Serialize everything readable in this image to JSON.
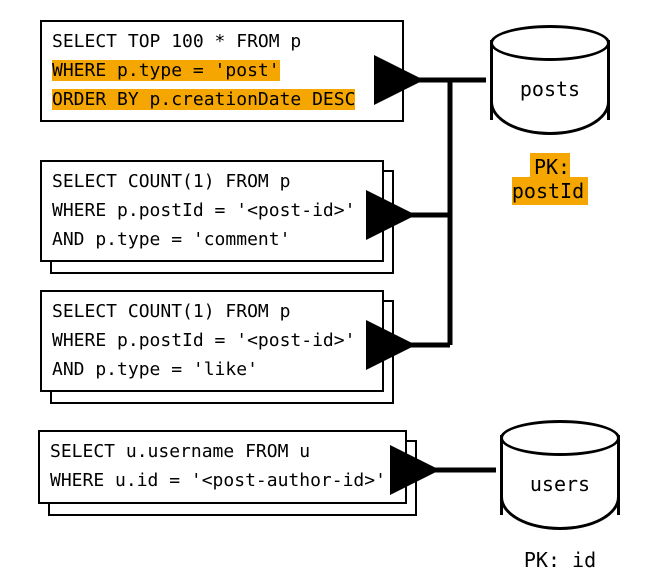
{
  "queries": {
    "q1": {
      "line1": "SELECT TOP 100 * FROM p",
      "line2": "WHERE p.type = 'post'",
      "line3": "ORDER BY p.creationDate DESC"
    },
    "q2": {
      "line1": "SELECT COUNT(1) FROM p",
      "line2": "WHERE p.postId = '<post-id>'",
      "line3": "AND p.type = 'comment'"
    },
    "q3": {
      "line1": "SELECT COUNT(1) FROM p",
      "line2": "WHERE p.postId = '<post-id>'",
      "line3": "AND p.type = 'like'"
    },
    "q4": {
      "line1": "SELECT u.username FROM u",
      "line2": "WHERE u.id = '<post-author-id>'"
    }
  },
  "databases": {
    "posts": {
      "label": "posts",
      "pk": "PK: postId"
    },
    "users": {
      "label": "users",
      "pk": "PK: id"
    }
  },
  "chart_data": {
    "type": "diagram",
    "description": "Four SQL query boxes with arrows from two database cylinders",
    "query_boxes": [
      {
        "sql": "SELECT TOP 100 * FROM p WHERE p.type = 'post' ORDER BY p.creationDate DESC",
        "highlighted_lines": [
          "WHERE p.type = 'post'",
          "ORDER BY p.creationDate DESC"
        ],
        "stacked": false,
        "source_db": "posts"
      },
      {
        "sql": "SELECT COUNT(1) FROM p WHERE p.postId = '<post-id>' AND p.type = 'comment'",
        "highlighted_lines": [],
        "stacked": true,
        "source_db": "posts"
      },
      {
        "sql": "SELECT COUNT(1) FROM p WHERE p.postId = '<post-id>' AND p.type = 'like'",
        "highlighted_lines": [],
        "stacked": true,
        "source_db": "posts"
      },
      {
        "sql": "SELECT u.username FROM u WHERE u.id = '<post-author-id>'",
        "highlighted_lines": [],
        "stacked": true,
        "source_db": "users"
      }
    ],
    "databases": [
      {
        "name": "posts",
        "partition_key_label": "PK: postId",
        "pk_highlighted": true
      },
      {
        "name": "users",
        "partition_key_label": "PK: id",
        "pk_highlighted": false
      }
    ]
  }
}
